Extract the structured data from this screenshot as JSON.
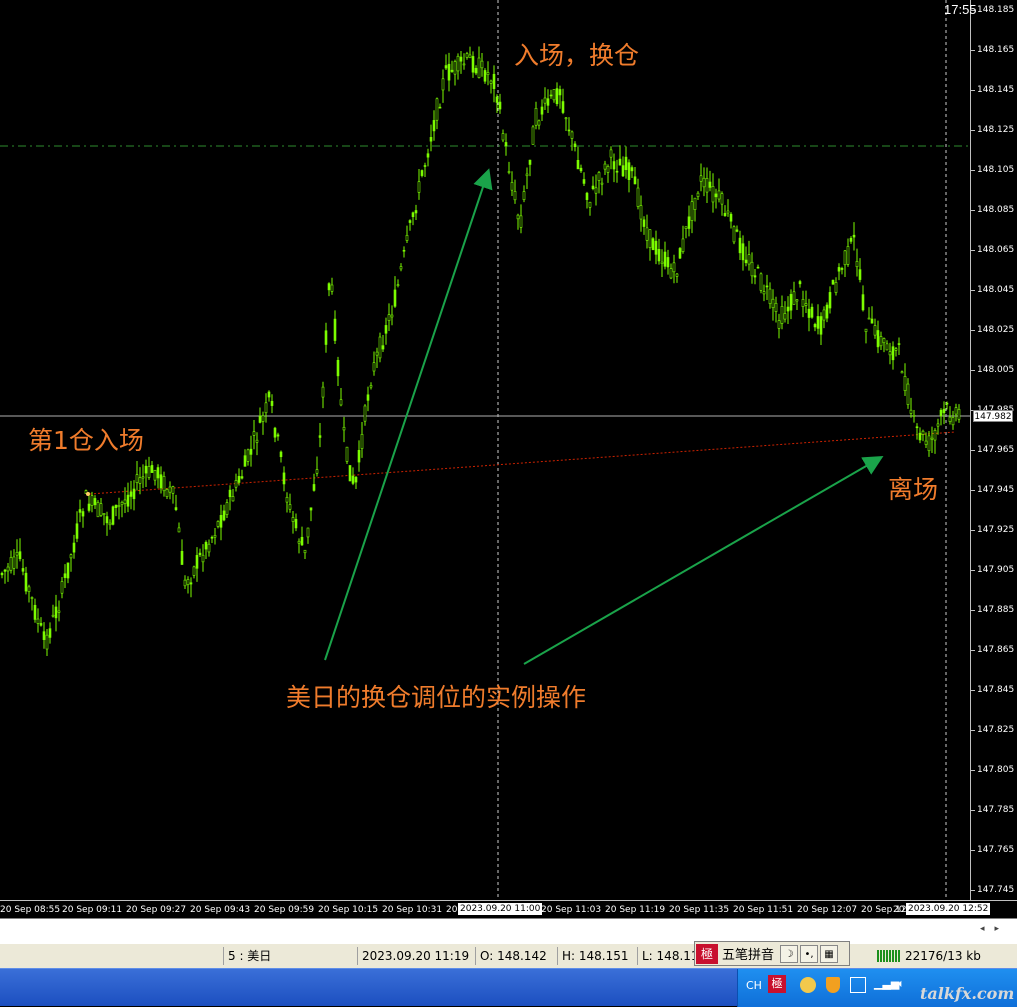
{
  "chart": {
    "symbol": "5 : 美日",
    "price_ticks": [
      "148.185",
      "148.165",
      "148.145",
      "148.125",
      "148.105",
      "148.085",
      "148.065",
      "148.045",
      "148.025",
      "148.005",
      "147.985",
      "147.965",
      "147.945",
      "147.925",
      "147.905",
      "147.885",
      "147.865",
      "147.845",
      "147.825",
      "147.805",
      "147.785",
      "147.765",
      "147.745"
    ],
    "price_cursor_label": "147.982",
    "time_ticks": [
      "20 Sep 08:55",
      "20 Sep 09:11",
      "20 Sep 09:27",
      "20 Sep 09:43",
      "20 Sep 09:59",
      "20 Sep 10:15",
      "20 Sep 10:31",
      "20",
      "20 Sep 11:03",
      "20 Sep 11:19",
      "20 Sep 11:35",
      "20 Sep 11:51",
      "20 Sep 12:07",
      "20 Sep 12:23",
      "20"
    ],
    "time_cursor_label": "2023.09.20 11:00",
    "time_cursor_label_right": "2023.09.20 12:52",
    "colors": {
      "candle": "#7CFC00",
      "annotation": "#f07c2c",
      "arrow": "#1aa34a",
      "dash_green": "#2e8b2e",
      "dash_red": "#cc2200"
    }
  },
  "annotations": {
    "entry_first": "第1仓入场",
    "entry_switch": "入场，换仓",
    "exit": "离场",
    "caption": "美日的换仓调位的实例操作"
  },
  "status": {
    "datetime": "2023.09.20 11:19",
    "open": "O: 148.142",
    "high": "H: 148.151",
    "low": "L: 148.11",
    "traffic": "22176/13 kb"
  },
  "ime": {
    "logo": "極",
    "name": "五笔拼音",
    "moon": "☽",
    "punct": "•,",
    "keyboard": "▦"
  },
  "taskbar": {
    "lang": "CH",
    "clock": "17:55",
    "watermark": "talkfx.com"
  }
}
